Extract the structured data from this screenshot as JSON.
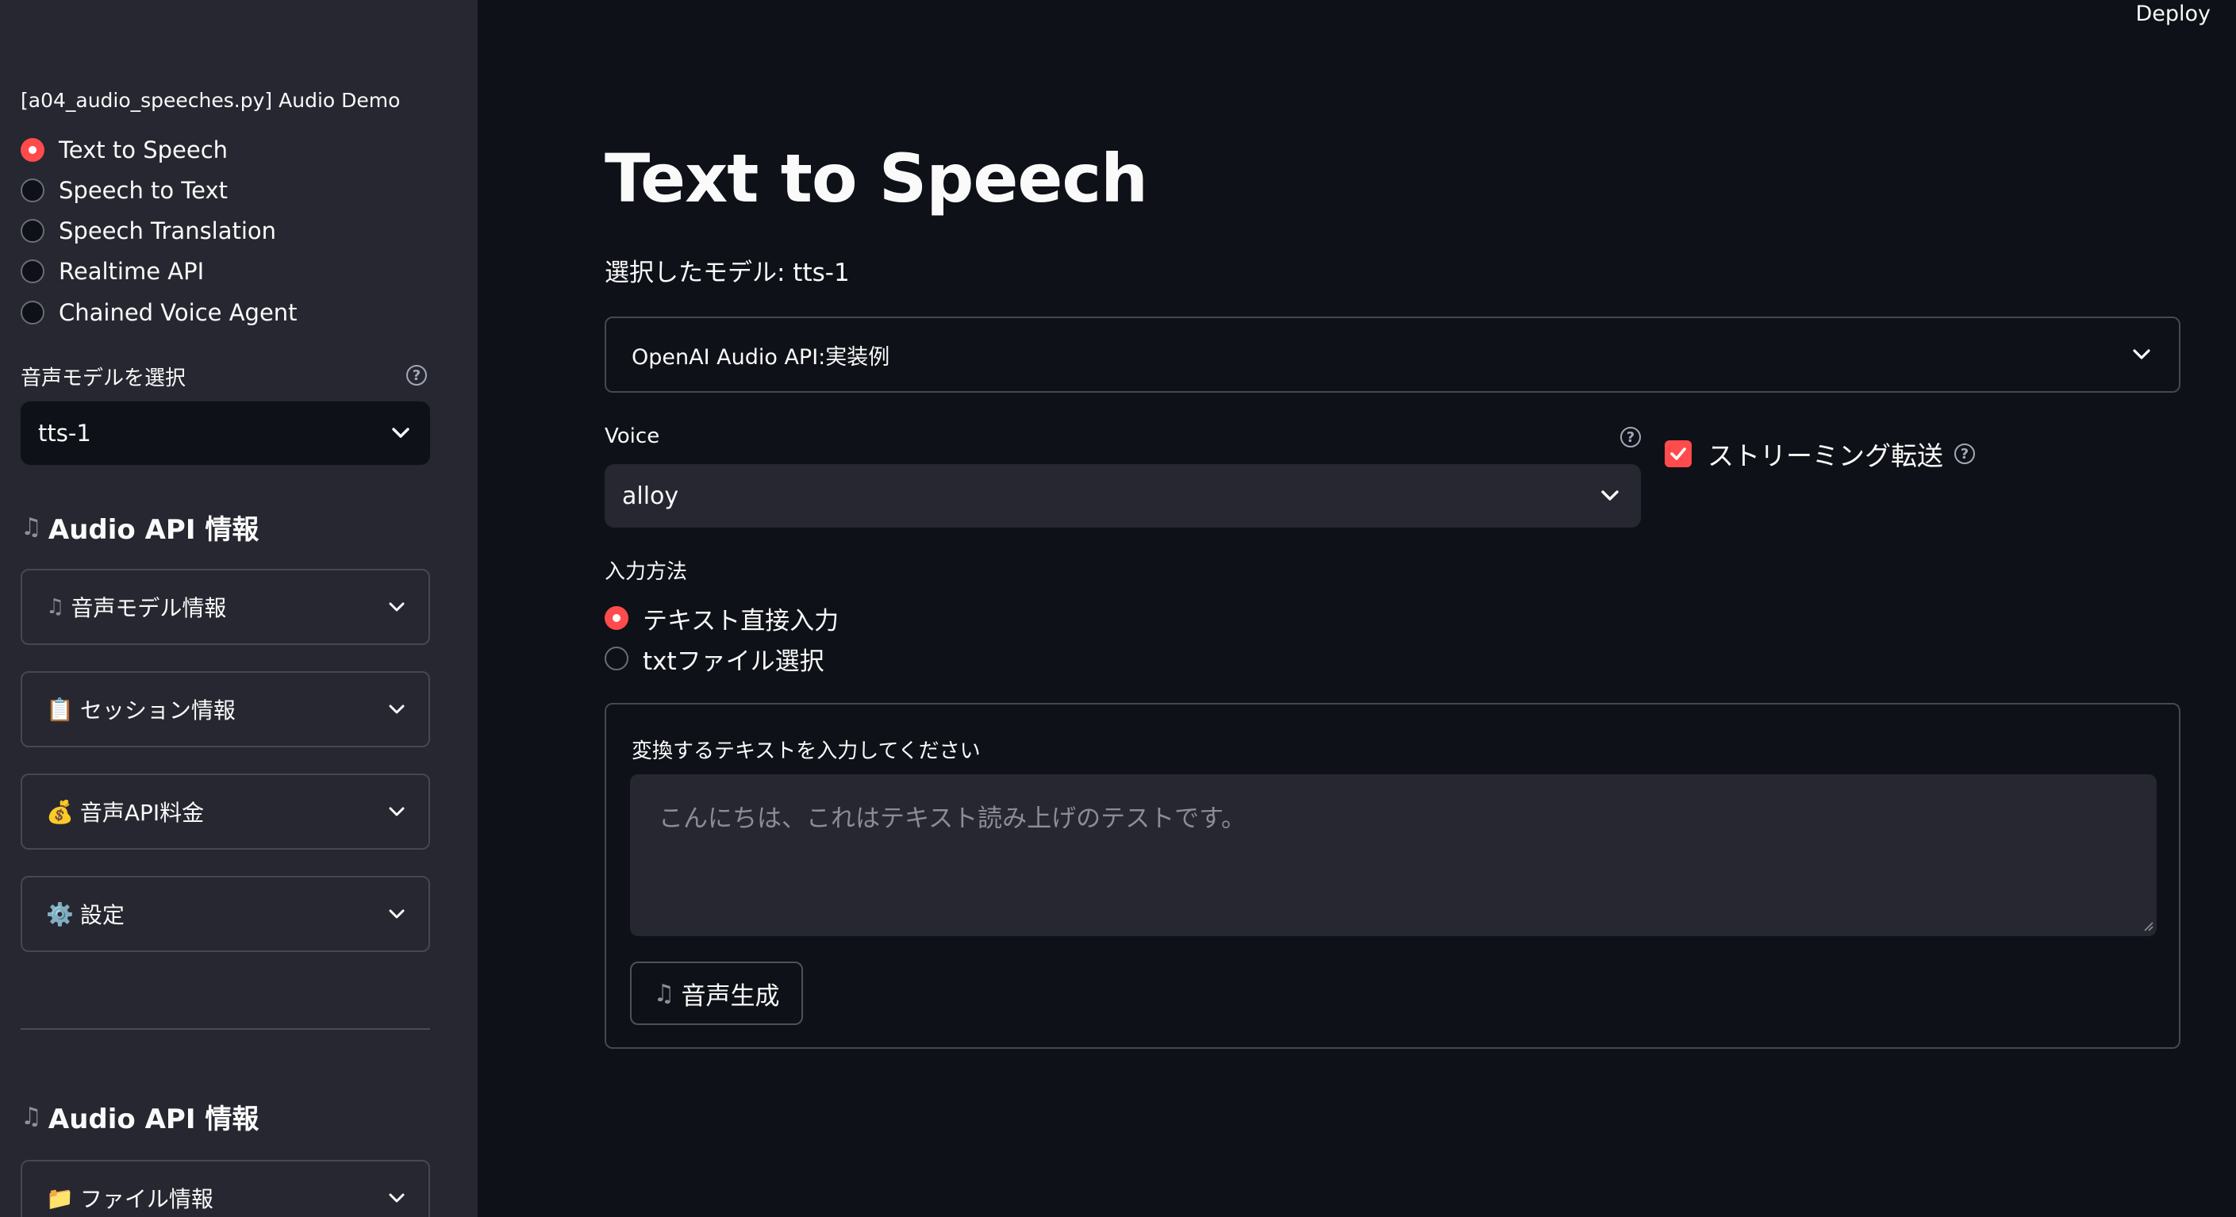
{
  "app": {
    "deploy_label": "Deploy"
  },
  "sidebar": {
    "caption": "[a04_audio_speeches.py] Audio Demo",
    "demos": [
      {
        "label": "Text to Speech",
        "selected": true
      },
      {
        "label": "Speech to Text",
        "selected": false
      },
      {
        "label": "Speech Translation",
        "selected": false
      },
      {
        "label": "Realtime API",
        "selected": false
      },
      {
        "label": "Chained Voice Agent",
        "selected": false
      }
    ],
    "model_label": "音声モデルを選択",
    "model_value": "tts-1",
    "info_heading_1": "Audio API 情報",
    "expanders": [
      {
        "icon": "musical-note-icon",
        "emoji": "🎵",
        "label": "音声モデル情報"
      },
      {
        "icon": "clipboard-icon",
        "emoji": "📋",
        "label": "セッション情報"
      },
      {
        "icon": "money-bag-icon",
        "emoji": "💰",
        "label": "音声API料金"
      },
      {
        "icon": "gear-icon",
        "emoji": "⚙️",
        "label": "設定"
      }
    ],
    "info_heading_2": "Audio API 情報",
    "file_expander": {
      "icon": "folder-icon",
      "emoji": "📁",
      "label": "ファイル情報"
    }
  },
  "main": {
    "title": "Text to Speech",
    "model_text": "選択したモデル: tts-1",
    "example_expander_label": "OpenAI Audio API:実装例",
    "voice_label": "Voice",
    "voice_value": "alloy",
    "streaming_label": "ストリーミング転送",
    "streaming_checked": true,
    "input_method_label": "入力方法",
    "input_methods": [
      {
        "label": "テキスト直接入力",
        "selected": true
      },
      {
        "label": "txtファイル選択",
        "selected": false
      }
    ],
    "textarea_label": "変換するテキストを入力してください",
    "textarea_placeholder": "こんにちは、これはテキスト読み上げのテストです。",
    "generate_button": "音声生成",
    "generate_icon": "musical-note-icon"
  },
  "colors": {
    "accent": "#ff4b4b",
    "background": "#0e1117",
    "sidebar": "#262730",
    "border": "#464851"
  }
}
